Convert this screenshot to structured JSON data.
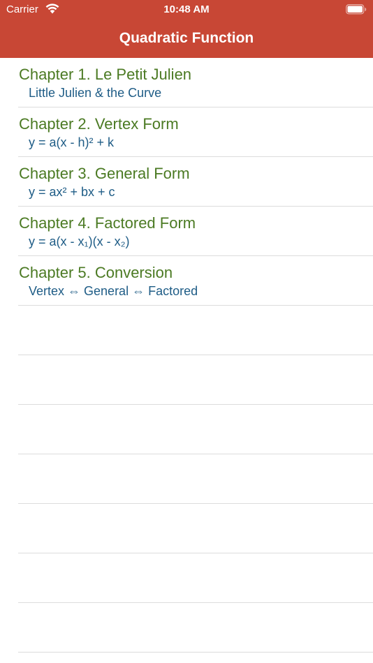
{
  "status_bar": {
    "carrier": "Carrier",
    "time": "10:48 AM"
  },
  "nav": {
    "title": "Quadratic Function"
  },
  "colors": {
    "bar": "#c84735",
    "chapter_title": "#4b7a23",
    "chapter_subtitle": "#1e5c86"
  },
  "chapters": [
    {
      "title": "Chapter 1. Le Petit Julien",
      "subtitle": "Little Julien & the Curve"
    },
    {
      "title": "Chapter 2. Vertex Form",
      "subtitle": "y = a(x - h)² + k"
    },
    {
      "title": "Chapter 3. General Form",
      "subtitle": "y = ax² + bx + c"
    },
    {
      "title": "Chapter 4. Factored Form",
      "subtitle": "y = a(x - x₁)(x - x₂)"
    },
    {
      "title": "Chapter 5. Conversion",
      "subtitle": "Vertex ⇔ General ⇔ Factored"
    }
  ]
}
